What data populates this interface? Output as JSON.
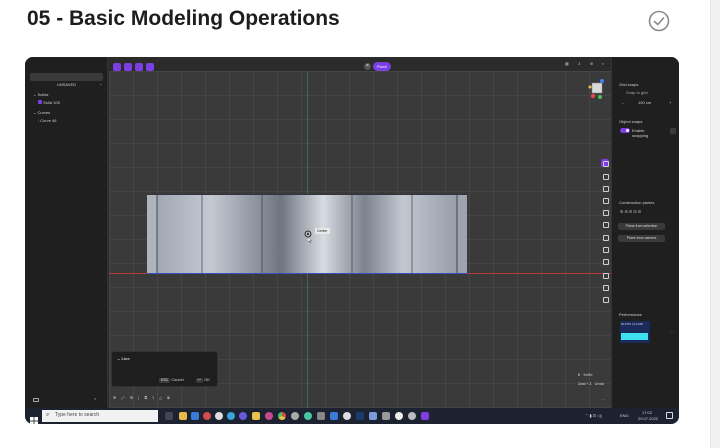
{
  "page": {
    "title": "05 - Basic Modeling Operations"
  },
  "app": {
    "left_panel": {
      "header_button": "UNSAVED",
      "tree": [
        {
          "label": "Solids",
          "group": true
        },
        {
          "label": "Solid 105",
          "group": false
        },
        {
          "label": "Curves",
          "group": true
        },
        {
          "label": "Curve 46",
          "group": false
        }
      ]
    },
    "toolbar": {
      "chip_label": "Fixed"
    },
    "viewport": {
      "snap_label": "Center"
    },
    "right_panel": {
      "grid_snaps_title": "Grid snaps",
      "snap_to_grid": "Snap to grid",
      "grid_value": "100 cm",
      "object_snaps_title": "Object snaps",
      "enable_snapping": "Enable snapping",
      "construction_planes_title": "Construction planes",
      "plane_from_selection": "Plane from selection",
      "plane_from_camera": "Plane from camera",
      "performance_title": "Performance",
      "performance_readout": "60 FPS | 0.0 MS"
    },
    "line_panel": {
      "title": "Line",
      "esc_key": "ESC",
      "cancel": "Cancel",
      "enter_key": "↵",
      "ok": "OK"
    },
    "shortcuts": [
      {
        "key": "K",
        "label": "Knife"
      },
      {
        "key": "Cmd + Z",
        "label": "Undo"
      }
    ]
  },
  "taskbar": {
    "search_placeholder": "Type here to search",
    "time": "17:02",
    "date": "29.07.2022",
    "lang": "ENG"
  },
  "colors": {
    "accent": "#7b3fe4",
    "taskbar": "#1c2230"
  }
}
